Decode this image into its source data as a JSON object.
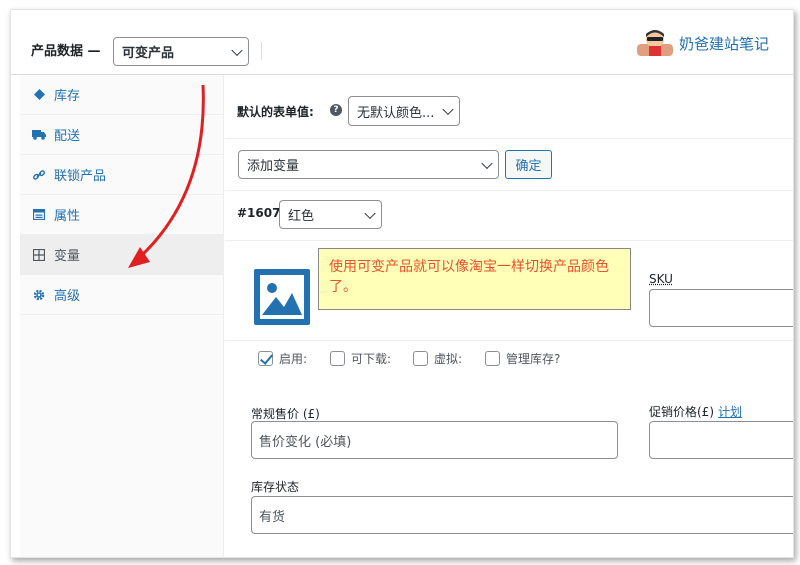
{
  "header": {
    "title": "产品数据 —",
    "product_type": "可变产品",
    "watermark": "奶爸建站笔记"
  },
  "sidebar": {
    "items": [
      {
        "label": "库存",
        "icon": "diamond-icon"
      },
      {
        "label": "配送",
        "icon": "truck-icon"
      },
      {
        "label": "联锁产品",
        "icon": "link-icon"
      },
      {
        "label": "属性",
        "icon": "list-icon"
      },
      {
        "label": "变量",
        "icon": "grid-icon"
      },
      {
        "label": "高级",
        "icon": "gear-icon"
      }
    ]
  },
  "main": {
    "default_label": "默认的表单值:",
    "default_color": "无默认颜色...",
    "add_variation": "添加变量",
    "confirm_label": "确定",
    "variation_id": "#1607",
    "variation_color": "红色",
    "tooltip": "使用可变产品就可以像淘宝一样切换产品颜色了。",
    "sku_label": "SKU",
    "checkboxes": [
      {
        "label": "启用:",
        "checked": true
      },
      {
        "label": "可下载:",
        "checked": false
      },
      {
        "label": "虚拟:",
        "checked": false
      },
      {
        "label": "管理库存?",
        "checked": false
      }
    ],
    "regular_price_label": "常规售价 (£)",
    "regular_price_placeholder": "售价变化 (必填)",
    "sale_price_label": "促销价格(£)",
    "schedule_link": "计划",
    "stock_label": "库存状态",
    "stock_value": "有货"
  },
  "colors": {
    "accent": "#2271b1",
    "annotation": "#e02020",
    "tooltip_bg": "#ffffb7"
  }
}
